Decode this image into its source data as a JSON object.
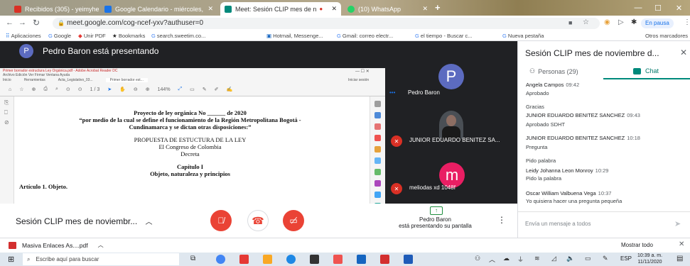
{
  "browser": {
    "tabs": [
      {
        "label": "Recibidos (305) - yeimyhelenag@",
        "icon_color": "#d93025"
      },
      {
        "label": "Google Calendario - miércoles,",
        "icon_color": "#1a73e8"
      },
      {
        "label": "Meet: Sesión CLIP mes de n",
        "icon_color": "#00897b"
      },
      {
        "label": "(10) WhatsApp",
        "icon_color": "#25d366"
      }
    ],
    "new_tab": "+",
    "url": "meet.google.com/cog-ncef-yxv?authuser=0",
    "profile_status": "En pausa",
    "bookmarks": [
      "Aplicaciones",
      "Google",
      "Unir PDF",
      "Bookmarks",
      "search.sweetim.co...",
      "Hotmail, Messenge...",
      "Gmail: correo electr...",
      "el tiempo - Buscar c...",
      "Nueva pestaña",
      "Otros marcadores"
    ]
  },
  "meet": {
    "presenter_initial": "P",
    "presenter_text": "Pedro Baron está presentando",
    "participants": [
      {
        "name": "Pedro Baron",
        "initial": "P",
        "color": "#5c6bc0"
      },
      {
        "name": "JUNIOR EDUARDO BENITEZ SA...",
        "initial": "",
        "color": "#3c4043"
      },
      {
        "name": "meliodas xd 1048f",
        "initial": "m",
        "color": "#e91e63"
      }
    ],
    "meeting_title_short": "Sesión CLIP mes de noviembr...",
    "presenting_name": "Pedro Baron",
    "presenting_text": "está presentando su pantalla",
    "colors": {
      "red": "#ea4335",
      "accent": "#1e8e3e"
    }
  },
  "pdf": {
    "window_title": "Primer borrador estructura Ley Orgánica.pdf - Adobe Acrobat Reader DC",
    "menu": "Archivo  Edición  Ver  Firmar  Ventana  Ayuda",
    "tabs": [
      "Inicio",
      "Herramientas",
      "Acta_Legislativo_03...",
      "Primer borrador est..."
    ],
    "sign_in": "Iniciar sesión",
    "zoom": "144%",
    "doc_lines": [
      {
        "text": "Proyecto de ley orgánica No ______ de 2020",
        "bold": true
      },
      {
        "text": "“por medio de la cual se define el funcionamiento de la Región Metropolitana Bogotá -",
        "bold": true
      },
      {
        "text": "Cundinamarca y se dictan otras disposiciones:”",
        "bold": true
      },
      {
        "text": "PROPUESTA DE ESTUCTURA DE LA LEY",
        "bold": false
      },
      {
        "text": "El Congreso de Colombia",
        "bold": false
      },
      {
        "text": "Decreta",
        "bold": false
      },
      {
        "text": "Capítulo I",
        "bold": true
      },
      {
        "text": "Objeto, naturaleza y principios",
        "bold": true
      }
    ],
    "article": "Artículo 1. Objeto."
  },
  "chat": {
    "title": "Sesión CLIP mes de noviembre d...",
    "people_label": "Personas (29)",
    "chat_label": "Chat",
    "messages": [
      {
        "author": "Angela Campos",
        "time": "09:42",
        "lines": [
          "Aprobado",
          "Gracias"
        ]
      },
      {
        "author": "JUNIOR EDUARDO BENITEZ SANCHEZ",
        "time": "09:43",
        "lines": [
          "Aprobado SDHT"
        ]
      },
      {
        "author": "JUNIOR EDUARDO BENITEZ SANCHEZ",
        "time": "10:18",
        "lines": [
          "Pregunta",
          "Pido palabra"
        ]
      },
      {
        "author": "Leidy Johanna Leon Monroy",
        "time": "10:29",
        "lines": [
          "Pido la palabra"
        ]
      },
      {
        "author": "Oscar William Valbuena Vega",
        "time": "10:37",
        "lines": [
          "Yo quisiera hacer una pregunta pequeña"
        ]
      }
    ],
    "input_placeholder": "Envía un mensaje a todos"
  },
  "download": {
    "file": "Masiva Enlaces As....pdf",
    "show_all": "Mostrar todo"
  },
  "taskbar": {
    "search_placeholder": "Escribe aquí para buscar",
    "lang": "ESP",
    "time": "10:39 a. m.",
    "date": "11/11/2020"
  }
}
